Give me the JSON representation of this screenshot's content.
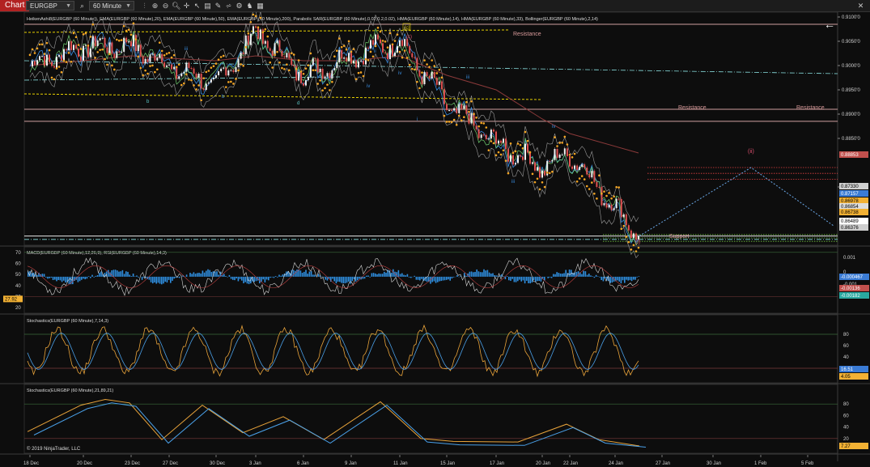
{
  "toolbar": {
    "chart_tab": "Chart",
    "instrument": "EURGBP",
    "interval": "60 Minute",
    "tool_icons": [
      "search-icon",
      "crosshair-icon",
      "zoom-icon",
      "line-tool-icon",
      "cursor-icon",
      "data-box-icon",
      "chart-style-icon",
      "pen-icon",
      "properties-icon",
      "strategy-icon",
      "tab-icon"
    ]
  },
  "colors": {
    "background": "#0d0d0d",
    "accent": "#b22222",
    "heiken_up": "#f2b134",
    "sar": "#f5a623",
    "ema200": "#8b3a3a",
    "hma": "#3a8de0",
    "bollinger": "#9a9a9a",
    "stoch_d": "#4aa0e8",
    "stoch_k": "#e8a33a",
    "macd_hist": "#2f8fe0",
    "resistance_line": "#d0a0a0",
    "yellow_dash": "#e6d000",
    "cyan_dashdot": "#8ae0e0",
    "projection": "#6aa7e6",
    "red_dotted": "#e04040",
    "green_dotted": "#70c040",
    "wave_label_green": "#5dc8c8"
  },
  "panel_price": {
    "indicators_label": "HeikenAshi8(EURGBP (60 Minute)), EMA(EURGBP (60 Minute),20), EMA(EURGBP (60 Minute),50), EMA(EURGBP (60 Minute),200), Parabolic SAR(EURGBP (60 Minute),0.02,0.2,0.02), HMA(EURGBP (60 Minute),14), HMA(EURGBP (60 Minute),33), Bollinger(EURGBP (60 Minute),2,14)",
    "y_ticks": [
      "0.9100'0",
      "0.9050'0",
      "0.9000'0",
      "0.8950'0",
      "0.8900'0",
      "0.8850'0",
      "0.8750'0"
    ],
    "price_badges": [
      {
        "text": "0.88853",
        "bg": "#c0504d",
        "fg": "#ffffff"
      },
      {
        "text": "0.87330",
        "bg": "#d0d0d0",
        "fg": "#000000"
      },
      {
        "text": "0.87157",
        "bg": "#3a7bd5",
        "fg": "#ffffff"
      },
      {
        "text": "0.86978",
        "bg": "#f2b134",
        "fg": "#000000"
      },
      {
        "text": "0.86854",
        "bg": "#dddddd",
        "fg": "#000000"
      },
      {
        "text": "0.86738",
        "bg": "#f2b134",
        "fg": "#000000"
      },
      {
        "text": "0.86489",
        "bg": "#ffffff",
        "fg": "#000000"
      },
      {
        "text": "0.86376",
        "bg": "#cfcfcf",
        "fg": "#000000"
      }
    ],
    "annotations": {
      "resistance_1": "Resistance",
      "resistance_2": "Resistance",
      "resistance_3": "Resistance",
      "support": "Support",
      "wave_ii": "(ii)",
      "wave_i": "(i)",
      "wave_c": "(c)",
      "wave_c_box": "[c]",
      "wave_iii": "iii",
      "wave_iv": "iv",
      "wave_iii_b": "iii",
      "wave_iv_b": "iv",
      "wave_i_b": "i",
      "wave_ii_b": "ii",
      "wave_b": "b",
      "wave_b2": "b",
      "wave_d": "d",
      "wave_c2": "c",
      "wave_iii_c": "iii",
      "wave_iv_c": "iv"
    }
  },
  "panel_macd": {
    "label": "MACD(EURGBP (60 Minute),12,26,9), RSI(EURGBP (60 Minute),14,3)",
    "left_ticks": [
      "70",
      "60",
      "50",
      "40",
      "30",
      "20"
    ],
    "rsi_badge": "27.92",
    "right_ticks": [
      "0.001",
      "0",
      "-0.001"
    ],
    "badges": [
      {
        "text": "-0.000467",
        "bg": "#3a7bd5",
        "fg": "#ffffff"
      },
      {
        "text": "-0.00136",
        "bg": "#c0504d",
        "fg": "#ffffff"
      },
      {
        "text": "-0.00182",
        "bg": "#2aa8a0",
        "fg": "#ffffff"
      }
    ]
  },
  "panel_stoch1": {
    "label": "Stochastics(EURGBP (60 Minute),7,14,3)",
    "right_ticks": [
      "80",
      "60",
      "40",
      "20"
    ],
    "badges": [
      {
        "text": "16.51",
        "bg": "#3a7bd5",
        "fg": "#ffffff"
      },
      {
        "text": "4.05",
        "bg": "#f2b134",
        "fg": "#000000"
      }
    ]
  },
  "panel_stoch2": {
    "label": "Stochastics(EURGBP (60 Minute),21,89,21)",
    "copyright": "© 2019 NinjaTrader, LLC",
    "right_ticks": [
      "80",
      "60",
      "40",
      "20"
    ],
    "badges": [
      {
        "text": "7.27",
        "bg": "#f2b134",
        "fg": "#000000"
      }
    ]
  },
  "x_axis": [
    "18 Dec",
    "20 Dec",
    "23 Dec",
    "27 Dec",
    "30 Dec",
    "3 Jan",
    "6 Jan",
    "9 Jan",
    "11 Jan",
    "15 Jan",
    "17 Jan",
    "20 Jan",
    "22 Jan",
    "24 Jan",
    "27 Jan",
    "30 Jan",
    "1 Feb",
    "5 Feb"
  ],
  "chart_data": {
    "type": "line",
    "title": "EURGBP (60 Minute)",
    "x": [
      "18 Dec",
      "20 Dec",
      "23 Dec",
      "27 Dec",
      "30 Dec",
      "3 Jan",
      "6 Jan",
      "9 Jan",
      "11 Jan",
      "15 Jan",
      "17 Jan",
      "20 Jan",
      "22 Jan",
      "24 Jan"
    ],
    "series": [
      {
        "name": "EURGBP (60 Minute)",
        "values": [
          0.9,
          0.904,
          0.904,
          0.9,
          0.896,
          0.907,
          0.898,
          0.902,
          0.905,
          0.892,
          0.884,
          0.879,
          0.882,
          0.8649
        ]
      },
      {
        "name": "EMA 200",
        "values": [
          0.9,
          0.901,
          0.902,
          0.9015,
          0.901,
          0.902,
          0.901,
          0.901,
          0.902,
          0.898,
          0.895,
          0.889,
          0.886,
          0.882
        ]
      }
    ],
    "ylim": [
      0.863,
      0.911
    ],
    "y_ticks": [
      0.91,
      0.905,
      0.9,
      0.895,
      0.89,
      0.885,
      0.875
    ],
    "horizontal_levels": {
      "resistance": [
        0.9085,
        0.891,
        0.88853
      ],
      "support": 0.8642,
      "current": 0.86489,
      "red_dotted_targets": [
        0.879,
        0.8778,
        0.8766
      ],
      "green_dotted_targets": [
        0.8652,
        0.8645,
        0.8638
      ]
    },
    "projection_path": [
      {
        "x": "25 Jan",
        "y": 0.8649
      },
      {
        "x": "31 Jan",
        "y": 0.879
      },
      {
        "x": "5 Feb",
        "y": 0.867
      }
    ],
    "macd": {
      "current": -0.000467,
      "signal": -0.00136,
      "diff": -0.00182
    },
    "rsi": {
      "current": 27.92
    },
    "stoch_7_14_3": {
      "d": 16.51,
      "k": 4.05,
      "levels": [
        80,
        20
      ]
    },
    "stoch_21_89_21": {
      "k": 7.27,
      "levels": [
        80,
        20
      ]
    },
    "grid": false,
    "legend": "top-left"
  }
}
